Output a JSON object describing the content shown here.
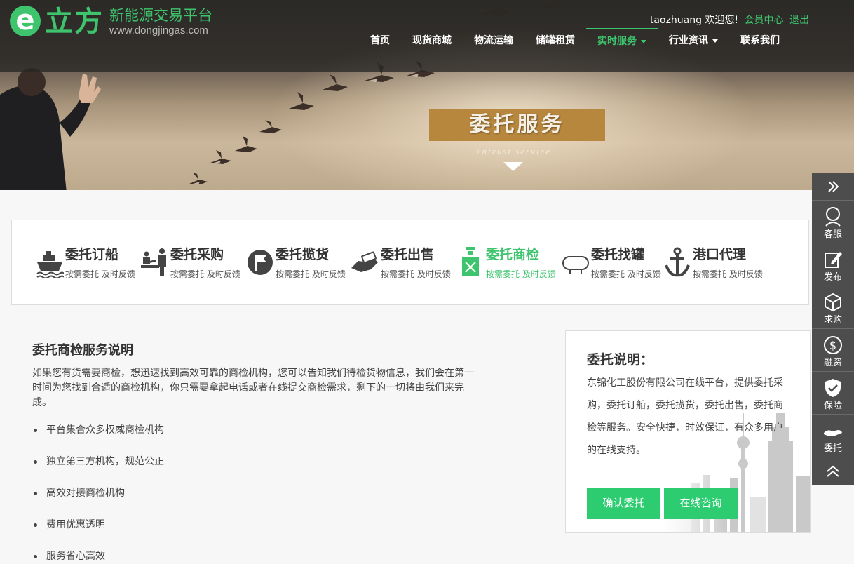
{
  "header": {
    "logo_mark": "e",
    "logo_name": "立方",
    "logo_tagline": "新能源交易平台",
    "logo_url": "www.dongjingas.com",
    "username": "taozhuang",
    "welcome": "欢迎您!",
    "member_center": "会员中心",
    "logout": "退出"
  },
  "nav": {
    "items": [
      {
        "label": "首页"
      },
      {
        "label": "现货商城"
      },
      {
        "label": "物流运输"
      },
      {
        "label": "储罐租赁"
      },
      {
        "label": "实时服务"
      },
      {
        "label": "行业资讯"
      },
      {
        "label": "联系我们"
      }
    ],
    "active_index": 4
  },
  "banner": {
    "title": "委托服务",
    "subtitle": "entrust service"
  },
  "services": [
    {
      "icon": "ship-icon",
      "name": "委托订船",
      "desc": "按需委托 及时反馈"
    },
    {
      "icon": "purchase-icon",
      "name": "委托采购",
      "desc": "按需委托 及时反馈"
    },
    {
      "icon": "flag-icon",
      "name": "委托揽货",
      "desc": "按需委托 及时反馈"
    },
    {
      "icon": "sale-icon",
      "name": "委托出售",
      "desc": "按需委托 及时反馈"
    },
    {
      "icon": "inspection-icon",
      "name": "委托商检",
      "desc": "按需委托 及时反馈"
    },
    {
      "icon": "tank-icon",
      "name": "委托找罐",
      "desc": "按需委托 及时反馈"
    },
    {
      "icon": "anchor-icon",
      "name": "港口代理",
      "desc": "按需委托 及时反馈"
    }
  ],
  "main": {
    "title": "委托商检服务说明",
    "intro": "如果您有货需要商检，想迅速找到高效可靠的商检机构，您可以告知我们待检货物信息，我们会在第一时间为您找到合适的商检机构，你只需要拿起电话或者在线提交商检需求，剩下的一切将由我们来完成。",
    "features": [
      "平台集合众多权威商检机构",
      "独立第三方机构，规范公正",
      "高效对接商检机构",
      "费用优惠透明",
      "服务省心高效"
    ]
  },
  "card": {
    "title": "委托说明：",
    "body": "东锦化工股份有限公司在线平台，提供委托采购，委托订船，委托揽货，委托出售，委托商检等服务。安全快捷，时效保证，有众多用户的在线支持。",
    "confirm_button": "确认委托",
    "consult_button": "在线咨询"
  },
  "sidebar": {
    "items": [
      {
        "icon": "collapse-icon",
        "label": ""
      },
      {
        "icon": "customer-service-icon",
        "label": "客服"
      },
      {
        "icon": "publish-icon",
        "label": "发布"
      },
      {
        "icon": "box-icon",
        "label": "求购"
      },
      {
        "icon": "dollar-icon",
        "label": "融资"
      },
      {
        "icon": "shield-check-icon",
        "label": "保险"
      },
      {
        "icon": "handshake-icon",
        "label": "委托"
      },
      {
        "icon": "back-to-top-icon",
        "label": ""
      }
    ]
  },
  "colors": {
    "brand_green": "#3ec46d",
    "button_green": "#2ecc71",
    "banner_title_bg": "#b8873e",
    "sidebar_bg": "#4d4d4d"
  }
}
